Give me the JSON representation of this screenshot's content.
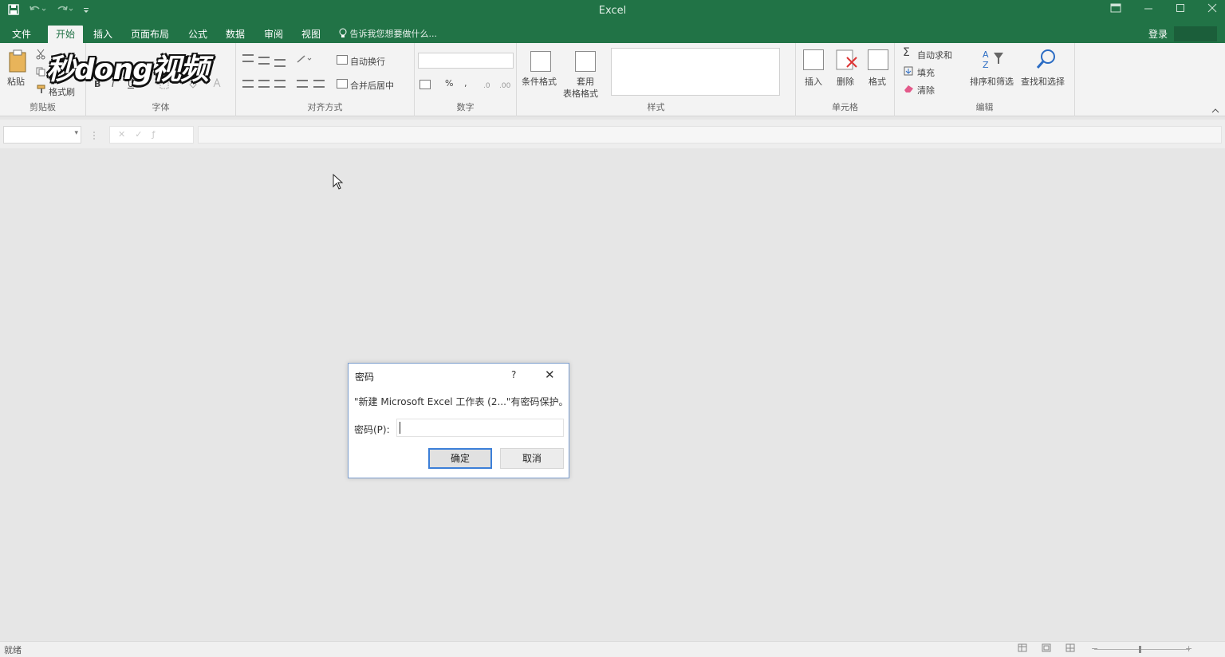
{
  "app": {
    "title": "Excel",
    "qat_icons": [
      "save-icon",
      "undo-icon",
      "redo-icon",
      "customize-qat-icon"
    ]
  },
  "tabs": [
    {
      "label": "文件",
      "active": false
    },
    {
      "label": "开始",
      "active": true
    },
    {
      "label": "插入",
      "active": false
    },
    {
      "label": "页面布局",
      "active": false
    },
    {
      "label": "公式",
      "active": false
    },
    {
      "label": "数据",
      "active": false
    },
    {
      "label": "审阅",
      "active": false
    },
    {
      "label": "视图",
      "active": false
    }
  ],
  "tell_me": "告诉我您想要做什么...",
  "login": "登录",
  "ribbon": {
    "clipboard": {
      "paste": "粘贴",
      "format_painter": "格式刷",
      "group": "剪贴板"
    },
    "font": {
      "bold": "B",
      "italic": "I",
      "underline": "U",
      "group": "字体"
    },
    "alignment": {
      "wrap_text": "自动换行",
      "merge_center": "合并后居中",
      "group": "对齐方式"
    },
    "number": {
      "percent": "%",
      "comma": ",",
      "group": "数字"
    },
    "styles": {
      "conditional": "条件格式",
      "table_top": "套用",
      "table_bottom": "表格格式",
      "group": "样式"
    },
    "cells": {
      "insert": "插入",
      "delete": "删除",
      "format": "格式",
      "group": "单元格"
    },
    "editing": {
      "autosum": "自动求和",
      "fill": "填充",
      "clear": "清除",
      "sort_filter": "排序和筛选",
      "find_select": "查找和选择",
      "group": "编辑",
      "sigma": "Σ"
    }
  },
  "watermark": "秒dong视频",
  "dialog": {
    "title": "密码",
    "help": "?",
    "close": "✕",
    "message": "\"新建 Microsoft Excel 工作表 (2...\"有密码保护。",
    "password_label": "密码(P):",
    "password_value": "",
    "ok": "确定",
    "cancel": "取消"
  },
  "status": {
    "ready": "就绪"
  }
}
